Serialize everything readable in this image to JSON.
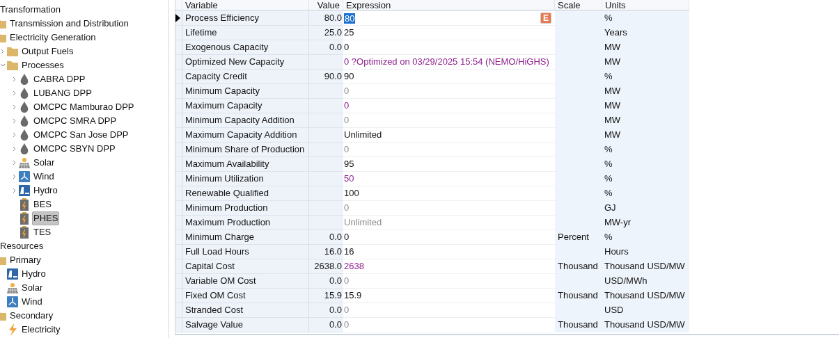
{
  "tree": [
    {
      "label": "Transformation",
      "children": [
        {
          "label": "Transmission and Distribution",
          "kind": "folder"
        },
        {
          "label": "Electricity Generation",
          "kind": "folder",
          "children": [
            {
              "label": "Output Fuels",
              "kind": "folder",
              "expanded": false,
              "selected": false
            },
            {
              "label": "Processes",
              "kind": "folder",
              "expanded": true,
              "selected": false,
              "children": [
                {
                  "label": "CABRA DPP",
                  "kind": "drop",
                  "expanded": false,
                  "selected": false
                },
                {
                  "label": "LUBANG DPP",
                  "kind": "drop",
                  "expanded": false,
                  "selected": false
                },
                {
                  "label": "OMCPC Mamburao DPP",
                  "kind": "drop",
                  "expanded": false,
                  "selected": false
                },
                {
                  "label": "OMCPC SMRA DPP",
                  "kind": "drop",
                  "expanded": false,
                  "selected": false
                },
                {
                  "label": "OMCPC San Jose DPP",
                  "kind": "drop",
                  "expanded": false,
                  "selected": false
                },
                {
                  "label": "OMCPC SBYN DPP",
                  "kind": "drop",
                  "expanded": false,
                  "selected": false
                },
                {
                  "label": "Solar",
                  "kind": "solar",
                  "expanded": false,
                  "selected": false
                },
                {
                  "label": "Wind",
                  "kind": "wind",
                  "expanded": false,
                  "selected": false
                },
                {
                  "label": "Hydro",
                  "kind": "hydro",
                  "expanded": false,
                  "selected": false
                },
                {
                  "label": "BES",
                  "kind": "battery",
                  "selected": false
                },
                {
                  "label": "PHES",
                  "kind": "battery",
                  "selected": true
                },
                {
                  "label": "TES",
                  "kind": "battery",
                  "selected": false
                }
              ]
            }
          ]
        }
      ]
    },
    {
      "label": "Resources",
      "children": [
        {
          "label": "Primary",
          "kind": "folder",
          "children": [
            {
              "label": "Hydro",
              "kind": "hydro",
              "selected": false
            },
            {
              "label": "Solar",
              "kind": "solar",
              "selected": false
            },
            {
              "label": "Wind",
              "kind": "wind",
              "selected": false
            }
          ]
        },
        {
          "label": "Secondary",
          "kind": "folder",
          "children": [
            {
              "label": "Electricity",
              "kind": "bolt",
              "selected": false
            }
          ]
        }
      ]
    }
  ],
  "table": {
    "columns": [
      "Variable",
      "Value",
      "Expression",
      "Scale",
      "Units"
    ],
    "rows": [
      {
        "variable": "Process Efficiency",
        "value": "80.0",
        "expression": "80",
        "kind": "set",
        "units": "%",
        "selected": true
      },
      {
        "variable": "Lifetime",
        "value": "25.0",
        "expression": "25",
        "kind": "set",
        "units": "Years",
        "selected": false
      },
      {
        "variable": "Exogenous Capacity",
        "value": "0.0",
        "expression": "0",
        "kind": "set",
        "units": "MW",
        "selected": false
      },
      {
        "variable": "Optimized New Capacity",
        "expression": "0 ?Optimized on 03/29/2025 15:54 (NEMO/HiGHS)",
        "kind": "result",
        "units": "MW",
        "selected": false
      },
      {
        "variable": "Capacity Credit",
        "value": "90.0",
        "expression": "90",
        "kind": "set",
        "units": "%",
        "selected": false
      },
      {
        "variable": "Minimum Capacity",
        "expression": "0",
        "kind": "default",
        "units": "MW",
        "selected": false
      },
      {
        "variable": "Maximum Capacity",
        "expression": "0",
        "kind": "result",
        "units": "MW",
        "selected": false
      },
      {
        "variable": "Minimum Capacity Addition",
        "expression": "0",
        "kind": "default",
        "units": "MW",
        "selected": false
      },
      {
        "variable": "Maximum Capacity Addition",
        "expression": "Unlimited",
        "kind": "set",
        "units": "MW",
        "selected": false
      },
      {
        "variable": "Minimum Share of Production",
        "expression": "0",
        "kind": "default",
        "units": "%",
        "selected": false
      },
      {
        "variable": "Maximum Availability",
        "expression": "95",
        "kind": "set",
        "units": "%",
        "selected": false
      },
      {
        "variable": "Minimum Utilization",
        "expression": "50",
        "kind": "result",
        "units": "%",
        "selected": false
      },
      {
        "variable": "Renewable Qualified",
        "expression": "100",
        "kind": "set",
        "units": "%",
        "selected": false
      },
      {
        "variable": "Minimum Production",
        "expression": "0",
        "kind": "default",
        "units": "GJ",
        "selected": false
      },
      {
        "variable": "Maximum Production",
        "expression": "Unlimited",
        "kind": "default",
        "units": "MW-yr",
        "selected": false
      },
      {
        "variable": "Minimum Charge",
        "value": "0.0",
        "expression": "0",
        "kind": "set",
        "scale": "Percent",
        "units": "%",
        "selected": false
      },
      {
        "variable": "Full Load Hours",
        "value": "16.0",
        "expression": "16",
        "kind": "set",
        "units": "Hours",
        "selected": false
      },
      {
        "variable": "Capital Cost",
        "value": "2638.0",
        "expression": "2638",
        "kind": "result",
        "scale": "Thousand",
        "units": "Thousand USD/MW",
        "selected": false
      },
      {
        "variable": "Variable OM Cost",
        "value": "0.0",
        "expression": "0",
        "kind": "default",
        "units": "USD/MWh",
        "selected": false
      },
      {
        "variable": "Fixed OM Cost",
        "value": "15.9",
        "expression": "15.9",
        "kind": "set",
        "scale": "Thousand",
        "units": "Thousand USD/MW",
        "selected": false
      },
      {
        "variable": "Stranded Cost",
        "value": "0.0",
        "expression": "0",
        "kind": "default",
        "units": "USD",
        "selected": false
      },
      {
        "variable": "Salvage Value",
        "value": "0.0",
        "expression": "0",
        "kind": "default",
        "scale": "Thousand",
        "units": "Thousand USD/MW",
        "selected": false
      }
    ]
  },
  "editor_button": "E"
}
